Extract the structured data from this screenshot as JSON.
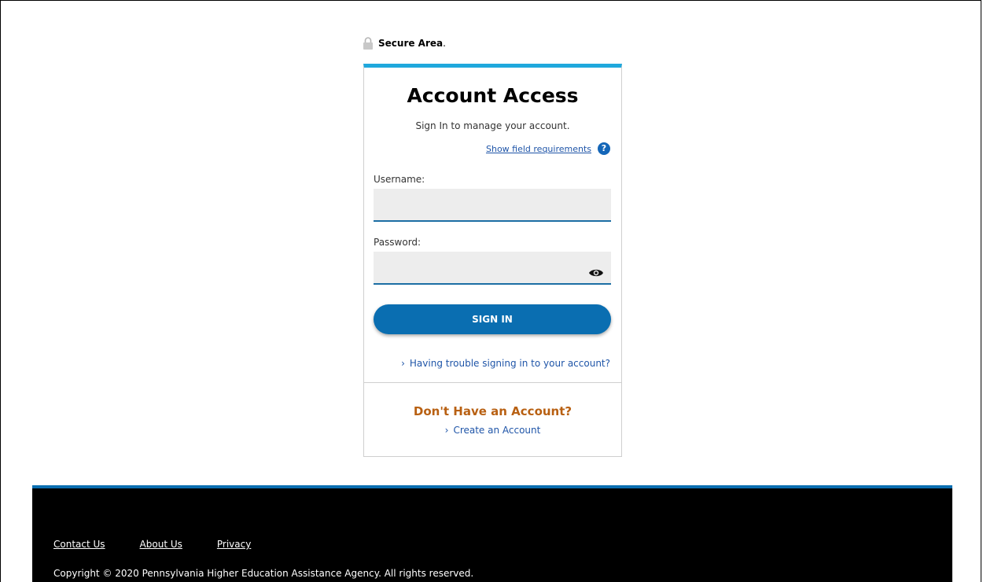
{
  "secure_area": {
    "label": "Secure Area",
    "suffix": ".",
    "icon": "lock-icon"
  },
  "login_card": {
    "title": "Account Access",
    "subtitle": "Sign In to manage your account.",
    "field_requirements_link": "Show field requirements",
    "help_icon": "question-circle-icon",
    "username_label": "Username:",
    "username_value": "",
    "password_label": "Password:",
    "password_value": "",
    "show_password_icon": "eye-icon",
    "signin_button": "SIGN IN",
    "trouble_link": "Having trouble signing in to your account?",
    "no_account_heading": "Don't Have an Account?",
    "create_account_link": "Create an Account"
  },
  "footer": {
    "links": [
      "Contact Us",
      "About Us",
      "Privacy"
    ],
    "copyright": "Copyright © 2020 Pennsylvania Higher Education Assistance Agency. All rights reserved."
  },
  "colors": {
    "accent": "#1fa8dd",
    "button": "#0a6eb1",
    "link": "#1f55a8",
    "heading_orange": "#b86012",
    "footer_bg": "#000000"
  }
}
